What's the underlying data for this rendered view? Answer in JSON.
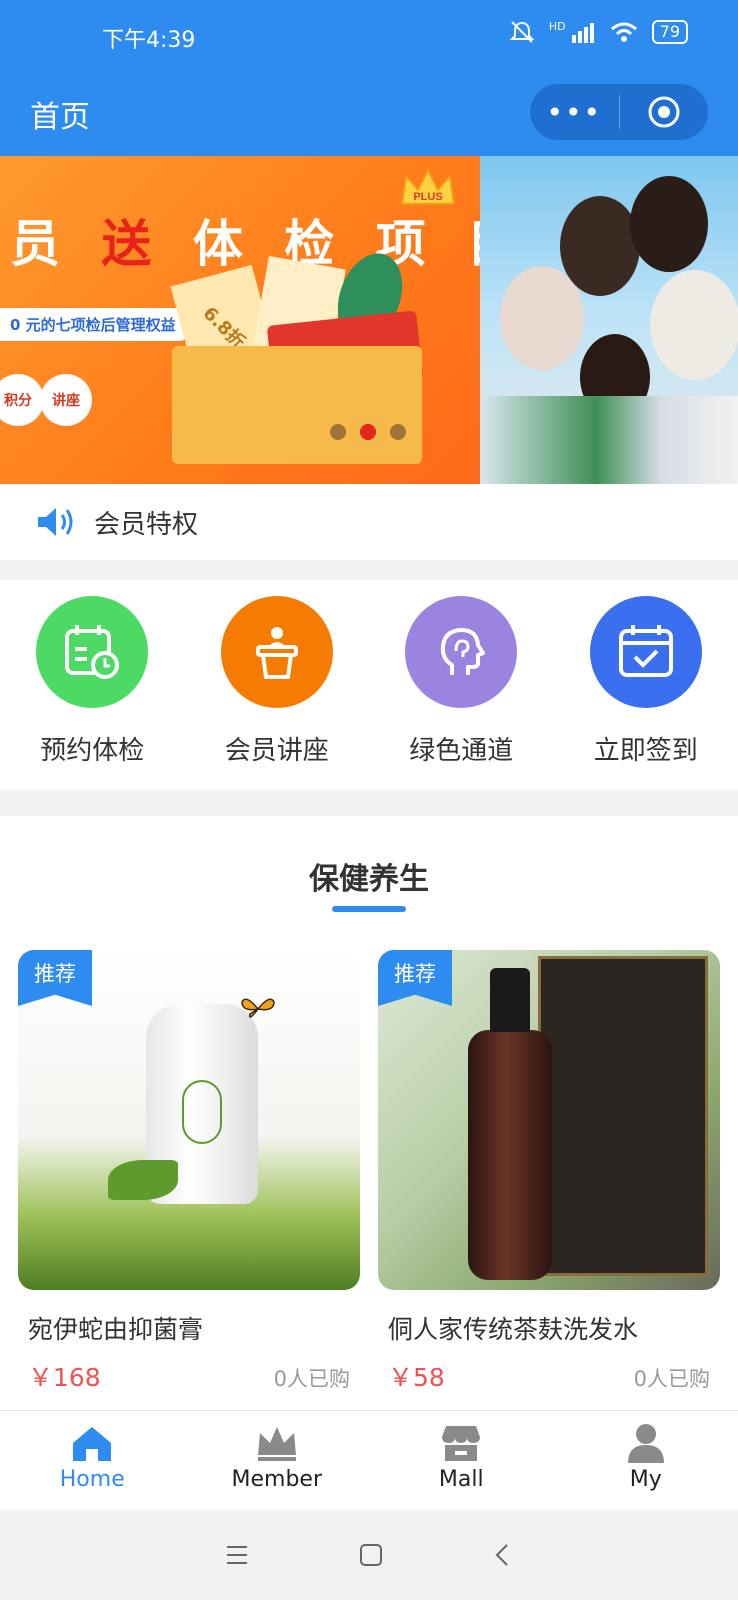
{
  "status": {
    "time": "下午4:39",
    "battery": "79",
    "network": "HD"
  },
  "nav": {
    "title": "首页",
    "more_glyph": "•••"
  },
  "banner": {
    "headline_a": "员 ",
    "headline_red": "送",
    "headline_b": " 体 检 项 目",
    "ribbon": "0 元的七项检后管理权益",
    "chip_1": "积分",
    "chip_2": "讲座",
    "ticket_text": "6.8折",
    "badge": "PLUS",
    "slide_count": 3,
    "active_slide": 2
  },
  "notice": {
    "text": "会员特权",
    "icon": "speaker-icon"
  },
  "quick_actions": [
    {
      "label": "预约体检",
      "color": "#4cd964",
      "icon": "calendar-clock-icon"
    },
    {
      "label": "会员讲座",
      "color": "#f57c00",
      "icon": "lecture-podium-icon"
    },
    {
      "label": "绿色通道",
      "color": "#9b84e0",
      "icon": "head-profile-icon"
    },
    {
      "label": "立即签到",
      "color": "#3a6ff0",
      "icon": "calendar-check-icon"
    }
  ],
  "section": {
    "title": "保健养生"
  },
  "products": [
    {
      "tag": "推荐",
      "name": "宛伊蛇由抑菌膏",
      "price": "￥168",
      "sold": "0人已购"
    },
    {
      "tag": "推荐",
      "name": "侗人家传统茶麸洗发水",
      "price": "￥58",
      "sold": "0人已购"
    }
  ],
  "tabs": [
    {
      "label": "Home",
      "icon": "home-icon",
      "active": true
    },
    {
      "label": "Member",
      "icon": "crown-icon",
      "active": false
    },
    {
      "label": "Mall",
      "icon": "store-icon",
      "active": false
    },
    {
      "label": "My",
      "icon": "user-icon",
      "active": false
    }
  ],
  "colors": {
    "primary": "#2e8cf0",
    "price": "#f0524f"
  }
}
